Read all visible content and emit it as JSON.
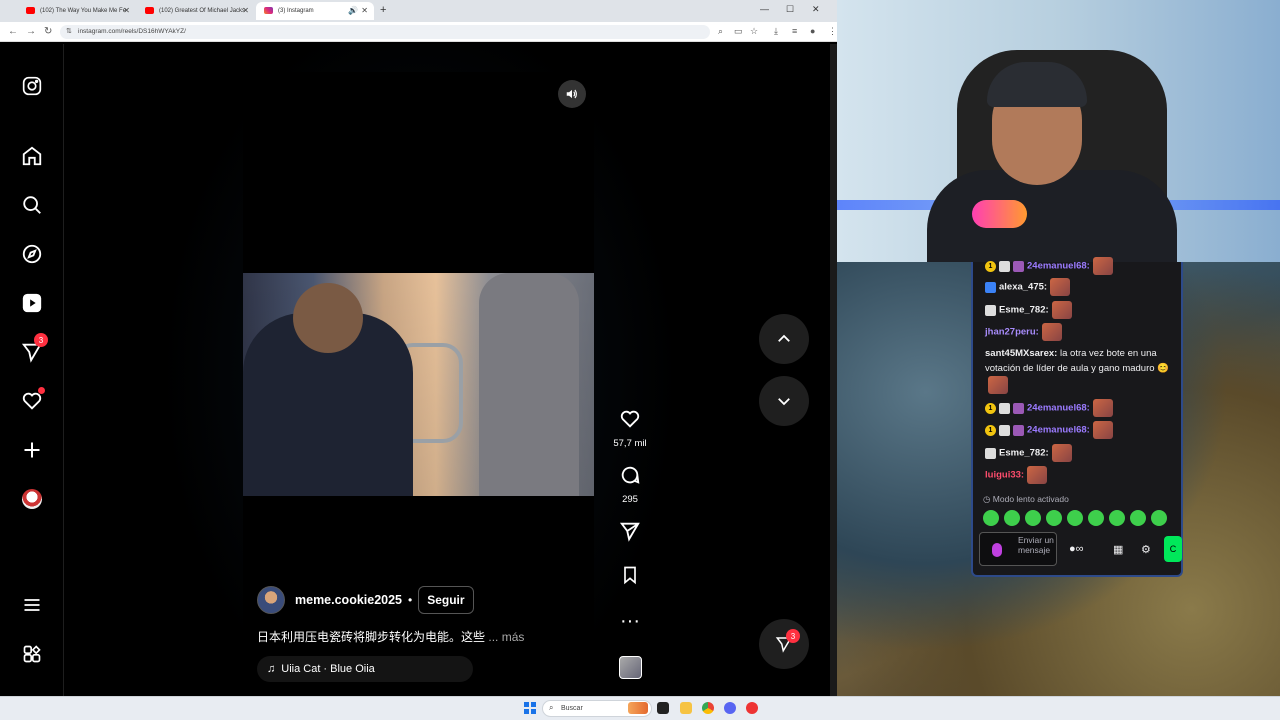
{
  "browser": {
    "tabs": [
      {
        "title": "(102) The Way You Make Me Fe"
      },
      {
        "title": "(102) Greatest Of Michael Jacks"
      },
      {
        "title": "(3) Instagram"
      }
    ],
    "new_tab": "+",
    "url": "instagram.com/reels/DS16hWYAkYZ/"
  },
  "instagram": {
    "sidebar": {
      "messages_badge": "3"
    },
    "reel": {
      "owner": "meme.cookie2025",
      "separator": "•",
      "follow_label": "Seguir",
      "caption": "日本利用压电瓷砖将脚步转化为电能。这些",
      "caption_more": "... más",
      "audio": "Uiia Cat · Blue Oiia"
    },
    "actions": {
      "likes": "57,7 mil",
      "comments": "295"
    },
    "floating_messages_badge": "3"
  },
  "chat": {
    "messages": [
      {
        "user": "24emanuel68:",
        "color": "#9b7bff",
        "text": ""
      },
      {
        "user": "alexa_475:",
        "color": "#ffffff",
        "text": ""
      },
      {
        "user": "Esme_782:",
        "color": "#ffffff",
        "text": ""
      },
      {
        "user": "jhan27peru:",
        "color": "#a78bfa",
        "text": ""
      },
      {
        "user": "sant45MXsarex:",
        "color": "#ffffff",
        "text": "la otra vez bote en una votación de líder de aula y gano maduro 😊"
      },
      {
        "user": "24emanuel68:",
        "color": "#9b7bff",
        "text": ""
      },
      {
        "user": "24emanuel68:",
        "color": "#9b7bff",
        "text": ""
      },
      {
        "user": "Esme_782:",
        "color": "#ffffff",
        "text": ""
      },
      {
        "user": "luigui33:",
        "color": "#ff4d6d",
        "text": ""
      }
    ],
    "slow_mode": "Modo lento activado",
    "input_placeholder": "Enviar un mensaje",
    "send_label": "C"
  },
  "taskbar": {
    "search_placeholder": "Buscar"
  }
}
